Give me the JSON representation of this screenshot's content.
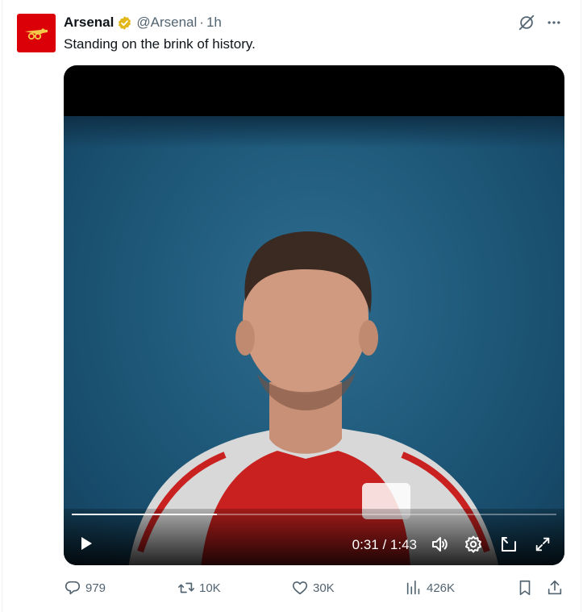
{
  "tweet": {
    "author_name": "Arsenal",
    "handle": "@Arsenal",
    "separator": "·",
    "time": "1h",
    "text": "Standing on the brink of history."
  },
  "video": {
    "current_time": "0:31",
    "duration": "1:43",
    "time_separator": " / ",
    "progress_fraction": 0.3
  },
  "actions": {
    "replies": "979",
    "retweets": "10K",
    "likes": "30K",
    "views": "426K"
  },
  "colors": {
    "brand_red": "#db0007",
    "verified_gold": "#e2b719",
    "muted_text": "#536471"
  },
  "icons": [
    "avatar-logo",
    "verified-badge-icon",
    "grok-icon",
    "more-icon",
    "play-icon",
    "volume-icon",
    "settings-icon",
    "pip-icon",
    "fullscreen-icon",
    "reply-icon",
    "retweet-icon",
    "like-icon",
    "views-icon",
    "bookmark-icon",
    "share-icon"
  ]
}
